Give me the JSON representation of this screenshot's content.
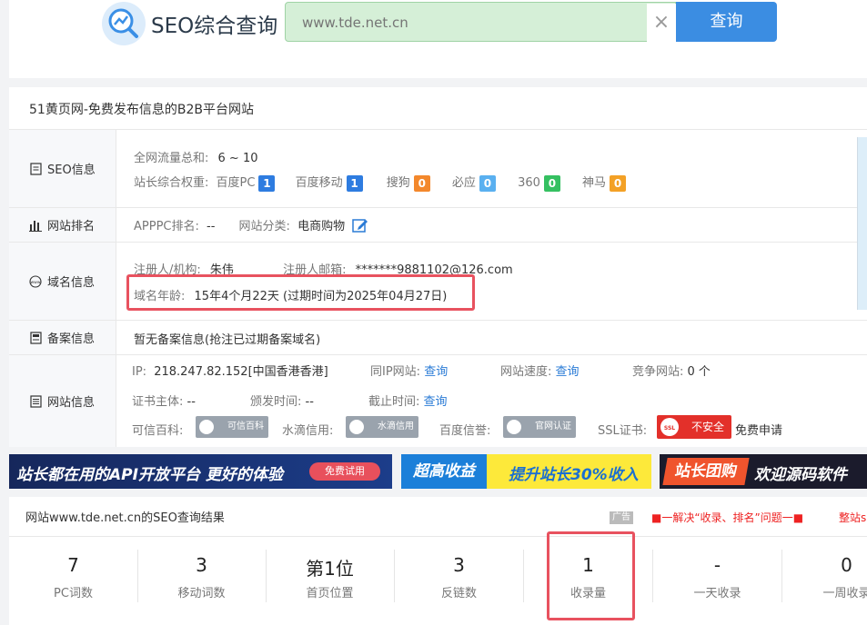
{
  "header": {
    "logo_text": "SEO综合查询",
    "search_placeholder": "www.tde.net.cn",
    "clear_glyph": "×",
    "search_button": "查询"
  },
  "site": {
    "title": "51黄页网-免费发布信息的B2B平台网站"
  },
  "seo_info": {
    "label": "SEO信息",
    "traffic_label": "全网流量总和:",
    "traffic_value": "6 ~ 10",
    "weight_label": "站长综合权重:",
    "weights": [
      {
        "name": "百度PC",
        "value": "1",
        "color": "#2e7ce0"
      },
      {
        "name": "百度移动",
        "value": "1",
        "color": "#2e7ce0"
      },
      {
        "name": "搜狗",
        "value": "0",
        "color": "#f3882c"
      },
      {
        "name": "必应",
        "value": "0",
        "color": "#5ab0f0"
      },
      {
        "name": "360",
        "value": "0",
        "color": "#35c061"
      },
      {
        "name": "神马",
        "value": "0",
        "color": "#f3a126"
      }
    ]
  },
  "ranking": {
    "label": "网站排名",
    "apppc_label": "APPPC排名:",
    "apppc_value": "--",
    "category_label": "网站分类:",
    "category_value": "电商购物"
  },
  "domain": {
    "label": "域名信息",
    "registrant_label": "注册人/机构:",
    "registrant_value": "朱伟",
    "email_label": "注册人邮箱:",
    "email_value": "*******9881102@126.com",
    "age_label": "域名年龄:",
    "age_value": "15年4个月22天 (过期时间为2025年04月27日)"
  },
  "beian": {
    "label": "备案信息",
    "text": "暂无备案信息(抢注已过期备案域名)"
  },
  "website": {
    "label": "网站信息",
    "ip_label": "IP:",
    "ip_value": "218.247.82.152[中国香港香港]",
    "same_ip_label": "同IP网站:",
    "same_ip_link": "查询",
    "speed_label": "网站速度:",
    "speed_link": "查询",
    "competitor_label": "竞争网站:",
    "competitor_value": "0 个",
    "cert_subject_label": "证书主体:",
    "cert_subject_value": "--",
    "issue_label": "颁发时间:",
    "issue_value": "--",
    "expire_label": "截止时间:",
    "expire_link": "查询",
    "kexin_label": "可信百科:",
    "kexin_badge": "可信百科",
    "shuidi_label": "水滴信用:",
    "shuidi_badge": "水滴信用",
    "baidu_label": "百度信誉:",
    "baidu_badge": "官网认证",
    "ssl_label": "SSL证书:",
    "ssl_badge": "不安全",
    "ssl_icon_text": "SSL",
    "ssl_apply": "免费申请"
  },
  "banners": {
    "b1_text": "站长都在用的API开放平台 更好的体验",
    "b1_btn": "免费试用",
    "b2_left": "超高收益",
    "b2_text": "提升站长30%收入",
    "b3_left": "站长团购",
    "b3_text": "欢迎源码软件"
  },
  "result": {
    "title": "网站www.tde.net.cn的SEO查询结果",
    "ad_tag": "广告",
    "ad_text1": "■一解决“收录、排名”问题一■",
    "ad_text2": "整站s",
    "stats": [
      {
        "value": "7",
        "label": "PC词数"
      },
      {
        "value": "3",
        "label": "移动词数"
      },
      {
        "value": "第1位",
        "label": "首页位置"
      },
      {
        "value": "3",
        "label": "反链数"
      },
      {
        "value": "1",
        "label": "收录量"
      },
      {
        "value": "-",
        "label": "一天收录"
      },
      {
        "value": "0",
        "label": "一周收录"
      }
    ]
  }
}
